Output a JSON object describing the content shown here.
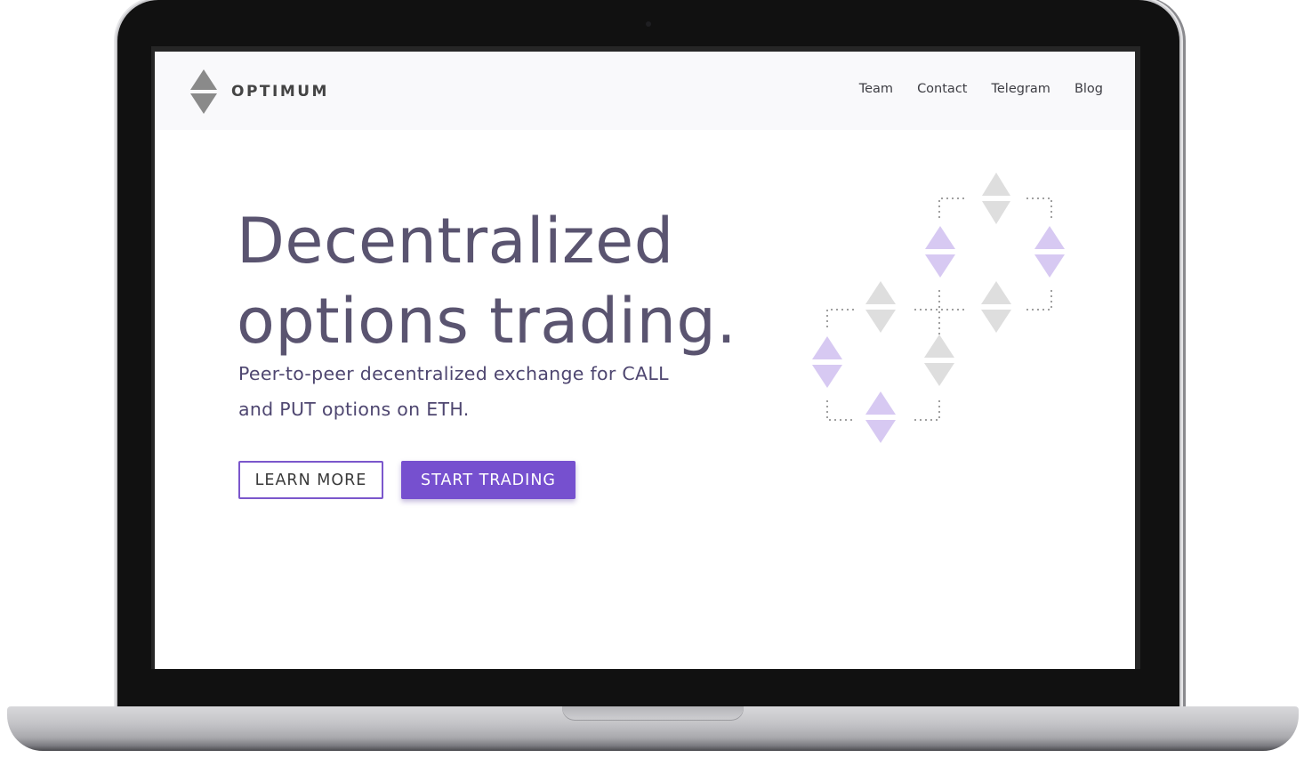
{
  "site": {
    "brand": {
      "name": "OPTIMUM",
      "logo_icon": "diamond-logo-icon"
    },
    "nav": [
      {
        "label": "Team"
      },
      {
        "label": "Contact"
      },
      {
        "label": "Telegram"
      },
      {
        "label": "Blog"
      }
    ],
    "hero": {
      "title_line1": "Decentralized",
      "title_line2": "options trading.",
      "subtitle_line1": "Peer-to-peer decentralized exchange for CALL",
      "subtitle_line2": "and PUT options on ETH.",
      "learn_more_label": "LEARN MORE",
      "start_trading_label": "START TRADING"
    }
  },
  "colors": {
    "accent": "#7650cf",
    "heading": "#5a5470",
    "nav_bg": "#f9f9fb",
    "diagram_purple": "#d6c8f2",
    "diagram_gray": "#e0e0e0"
  }
}
